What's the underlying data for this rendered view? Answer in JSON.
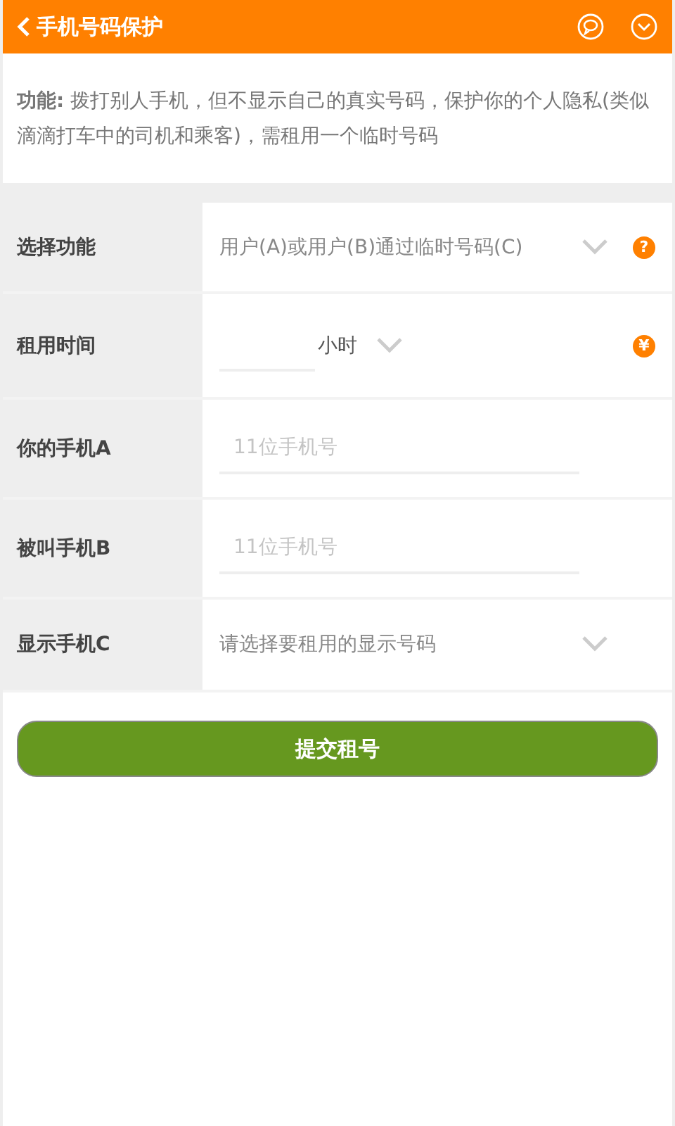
{
  "header": {
    "title": "手机号码保护"
  },
  "intro": {
    "text": "**功能:** 拨打别人手机，但不显示自己的真实号码，保护你的个人隐私(类似滴滴打车中的司机和乘客)，需租用一个临时号码"
  },
  "rows": [
    {
      "kind": "select",
      "label": "选择功能",
      "value": "用户(A)或用户(B)通过临时号码(C)",
      "badge": "?"
    },
    {
      "kind": "duration",
      "label": "租用时间",
      "unit": "小时",
      "badge": "¥"
    },
    {
      "kind": "input",
      "label": "你的手机A",
      "placeholder": "11位手机号"
    },
    {
      "kind": "input",
      "label": "被叫手机B",
      "placeholder": "11位手机号"
    },
    {
      "kind": "select",
      "label": "显示手机C",
      "value": "请选择要租用的显示号码"
    }
  ],
  "submit": {
    "label": "提交租号"
  }
}
